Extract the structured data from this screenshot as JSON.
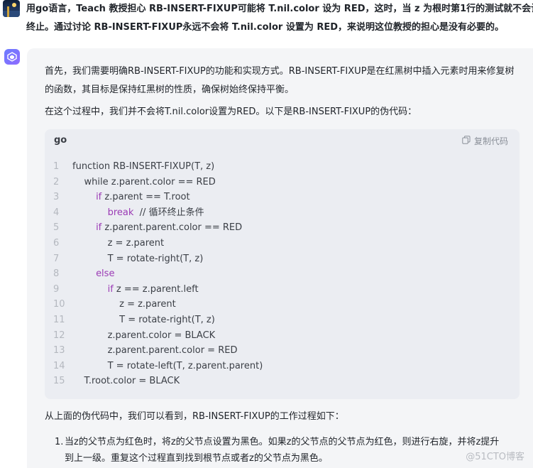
{
  "user": {
    "line1": "用go语言，Teach 教授担心 RB-INSERT-FIXUP可能将 T.nil.color 设为 RED，这时，当 z 为根时第1行的测试就不会让循环",
    "line2": "终止。通过讨论 RB-INSERT-FIXUP永远不会将 T.nil.color 设置为 RED，来说明这位教授的担心是没有必要的。"
  },
  "assistant": {
    "para1_line1": "首先，我们需要明确RB-INSERT-FIXUP的功能和实现方式。RB-INSERT-FIXUP是在红黑树中插入元素时用来修复树",
    "para1_line2": "的函数，其目标是保持红黑树的性质，确保树始终保持平衡。",
    "para2": "在这个过程中，我们并不会将T.nil.color设置为RED。以下是RB-INSERT-FIXUP的伪代码：",
    "code": {
      "language": "go",
      "copy_label": "复制代码",
      "lines": [
        {
          "n": "1",
          "indent": "",
          "kw": "",
          "text": "function RB-INSERT-FIXUP(T, z)"
        },
        {
          "n": "2",
          "indent": "    ",
          "kw": "",
          "text": "while z.parent.color == RED"
        },
        {
          "n": "3",
          "indent": "        ",
          "kw": "if",
          "text": " z.parent == T.root"
        },
        {
          "n": "4",
          "indent": "            ",
          "kw": "break",
          "text": "  // 循环终止条件"
        },
        {
          "n": "5",
          "indent": "        ",
          "kw": "if",
          "text": " z.parent.parent.color == RED"
        },
        {
          "n": "6",
          "indent": "            ",
          "kw": "",
          "text": "z = z.parent"
        },
        {
          "n": "7",
          "indent": "            ",
          "kw": "",
          "text": "T = rotate-right(T, z)"
        },
        {
          "n": "8",
          "indent": "        ",
          "kw": "else",
          "text": ""
        },
        {
          "n": "9",
          "indent": "            ",
          "kw": "if",
          "text": " z == z.parent.left"
        },
        {
          "n": "10",
          "indent": "                ",
          "kw": "",
          "text": "z = z.parent"
        },
        {
          "n": "11",
          "indent": "                ",
          "kw": "",
          "text": "T = rotate-right(T, z)"
        },
        {
          "n": "12",
          "indent": "            ",
          "kw": "",
          "text": "z.parent.color = BLACK"
        },
        {
          "n": "13",
          "indent": "            ",
          "kw": "",
          "text": "z.parent.parent.color = RED"
        },
        {
          "n": "14",
          "indent": "            ",
          "kw": "",
          "text": "T = rotate-left(T, z.parent.parent)"
        },
        {
          "n": "15",
          "indent": "    ",
          "kw": "",
          "text": "T.root.color = BLACK"
        }
      ]
    },
    "para3": "从上面的伪代码中，我们可以看到，RB-INSERT-FIXUP的工作过程如下：",
    "list": [
      {
        "num": "1.",
        "line1": "当z的父节点为红色时，将z的父节点设置为黑色。如果z的父节点的父节点为红色，则进行右旋，并将z提升",
        "line2": "到上一级。重复这个过程直到找到根节点或者z的父节点为黑色。"
      }
    ]
  },
  "watermark": "@51CTO博客",
  "colors": {
    "panel_bg": "#f4f5f7",
    "code_bg": "#ebedf2",
    "keyword": "#9b3bb5",
    "line_number": "#b4b8bf"
  }
}
